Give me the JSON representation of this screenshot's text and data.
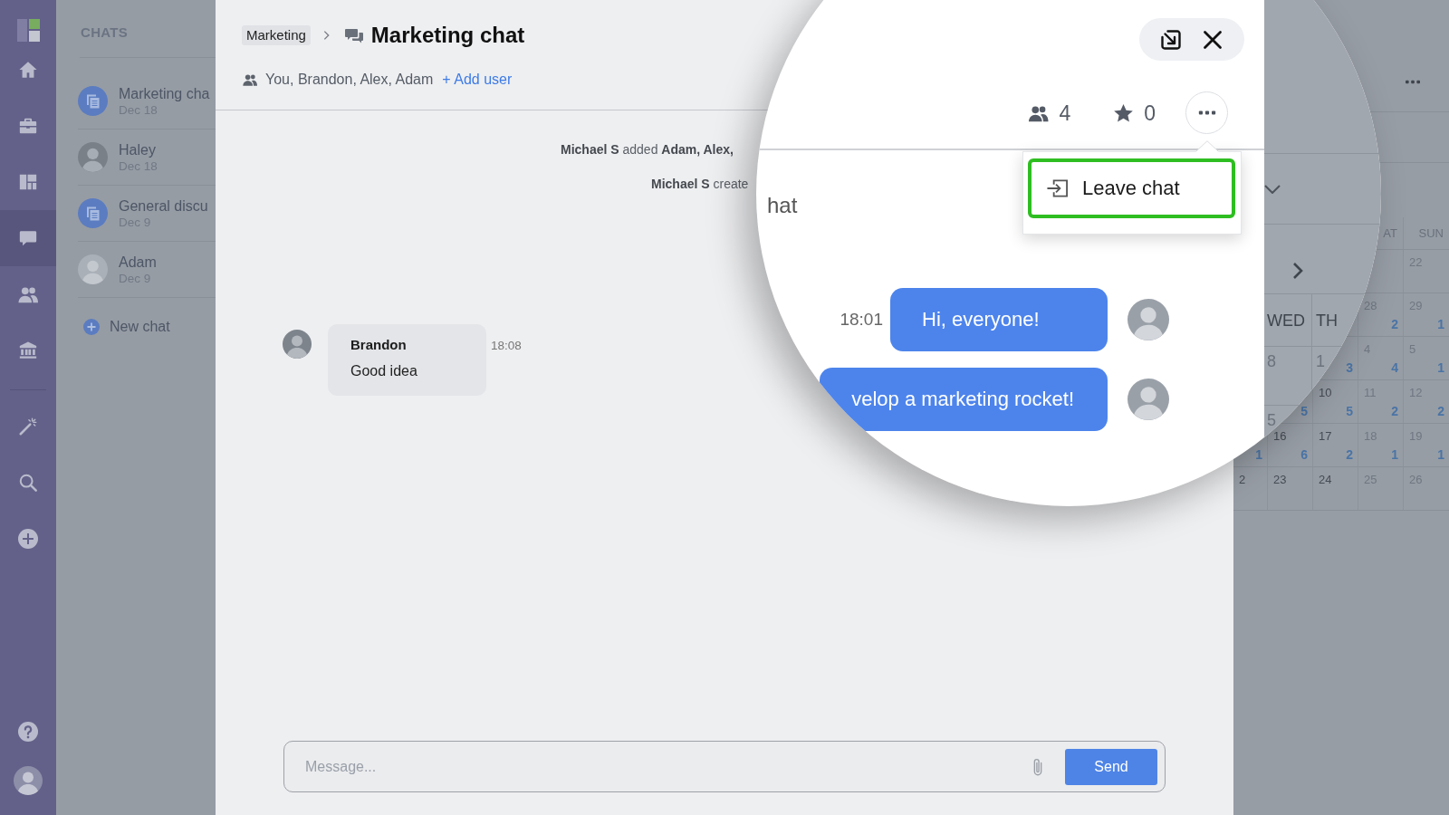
{
  "nav_rail": {
    "groups": [
      [
        {
          "kind": "home",
          "selected": false
        },
        {
          "kind": "briefcase",
          "selected": false
        },
        {
          "kind": "board",
          "selected": false
        },
        {
          "kind": "chat",
          "selected": true
        },
        {
          "kind": "people",
          "selected": false
        },
        {
          "kind": "bank",
          "selected": false
        }
      ],
      [
        {
          "kind": "wand",
          "selected": false
        },
        {
          "kind": "search",
          "selected": false
        },
        {
          "kind": "add",
          "selected": false
        }
      ]
    ],
    "footer": [
      {
        "kind": "help",
        "selected": false
      },
      {
        "kind": "avatar",
        "selected": false
      }
    ]
  },
  "chats_panel": {
    "title": "CHATS",
    "items": [
      {
        "kind": "group",
        "name": "Marketing cha",
        "date": "Dec 18"
      },
      {
        "kind": "person",
        "name": "Haley",
        "date": "Dec 18"
      },
      {
        "kind": "group",
        "name": "General discu",
        "date": "Dec 9"
      },
      {
        "kind": "person",
        "name": "Adam",
        "date": "Dec 9"
      }
    ],
    "new_chat": "New chat"
  },
  "chat": {
    "breadcrumb": "Marketing",
    "title": "Marketing chat",
    "members": "You, Brandon, Alex, Adam",
    "add_user": "+ Add user",
    "events": [
      "**Michael S** added **Adam, Alex,**",
      "**Michael S** create"
    ],
    "messages": [
      {
        "author": "Brandon",
        "text": "Good idea",
        "time": "18:08"
      }
    ],
    "composer": {
      "placeholder": "Message...",
      "send_label": "Send"
    }
  },
  "magnifier": {
    "members_count": "4",
    "stars_count": "0",
    "menu": [
      {
        "label": "Leave chat",
        "highlighted": true
      }
    ],
    "event_tail": "hat",
    "messages": [
      {
        "text": "Hi, everyone!",
        "time": "18:01"
      },
      {
        "text": "velop a marketing rocket!"
      }
    ],
    "calendar": {
      "weekdays": [
        "WED",
        "TH"
      ],
      "rows": [
        [
          "8",
          "1"
        ],
        [
          "5",
          ""
        ]
      ]
    }
  },
  "calendar": {
    "weekdays": [
      "AT",
      "SUN"
    ],
    "rows": [
      [
        "",
        "",
        "",
        "",
        {
          "day": "22"
        }
      ],
      [
        "",
        "",
        "",
        {
          "day": "28",
          "count": "2"
        },
        {
          "day": "29",
          "count": "1"
        }
      ],
      [
        "",
        "",
        {
          "count": "3"
        },
        {
          "day": "4",
          "count": "4"
        },
        {
          "day": "5",
          "count": "1"
        }
      ],
      [
        "",
        {
          "count": "5"
        },
        {
          "day": "10",
          "count": "5"
        },
        {
          "day": "11",
          "count": "2"
        },
        {
          "day": "12",
          "count": "2"
        }
      ],
      [
        {
          "count": "1"
        },
        {
          "day": "16",
          "count": "6"
        },
        {
          "day": "17",
          "count": "2"
        },
        {
          "day": "18",
          "count": "1"
        },
        {
          "day": "19",
          "count": "1"
        }
      ],
      [
        {
          "day": "2"
        },
        {
          "day": "23"
        },
        {
          "day": "24"
        },
        {
          "day": "25"
        },
        {
          "day": "26"
        }
      ]
    ]
  }
}
